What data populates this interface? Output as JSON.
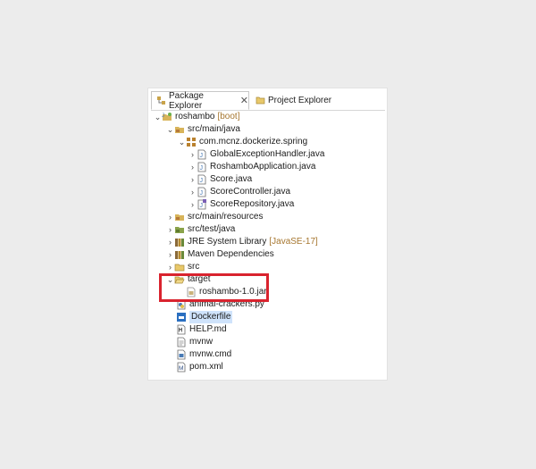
{
  "tabs": [
    {
      "label": "Package Explorer",
      "close": "✕"
    },
    {
      "label": "Project Explorer"
    }
  ],
  "tree": {
    "project": {
      "label": "roshambo",
      "decoration": "[boot]"
    },
    "src_main_java": "src/main/java",
    "package": "com.mcnz.dockerize.spring",
    "classes": [
      "GlobalExceptionHandler.java",
      "RoshamboApplication.java",
      "Score.java",
      "ScoreController.java",
      "ScoreRepository.java"
    ],
    "src_main_resources": "src/main/resources",
    "src_test_java": "src/test/java",
    "jre": {
      "label": "JRE System Library",
      "decoration": "[JavaSE-17]"
    },
    "maven": "Maven Dependencies",
    "src": "src",
    "target": "target",
    "jar": "roshambo-1.0.jar",
    "files": [
      "animal-crackers.py",
      "Dockerfile",
      "HELP.md",
      "mvnw",
      "mvnw.cmd",
      "pom.xml"
    ]
  },
  "colors": {
    "highlight": "#d9232e",
    "decoration": "#a6762f",
    "selection": "#cfe3fb"
  }
}
